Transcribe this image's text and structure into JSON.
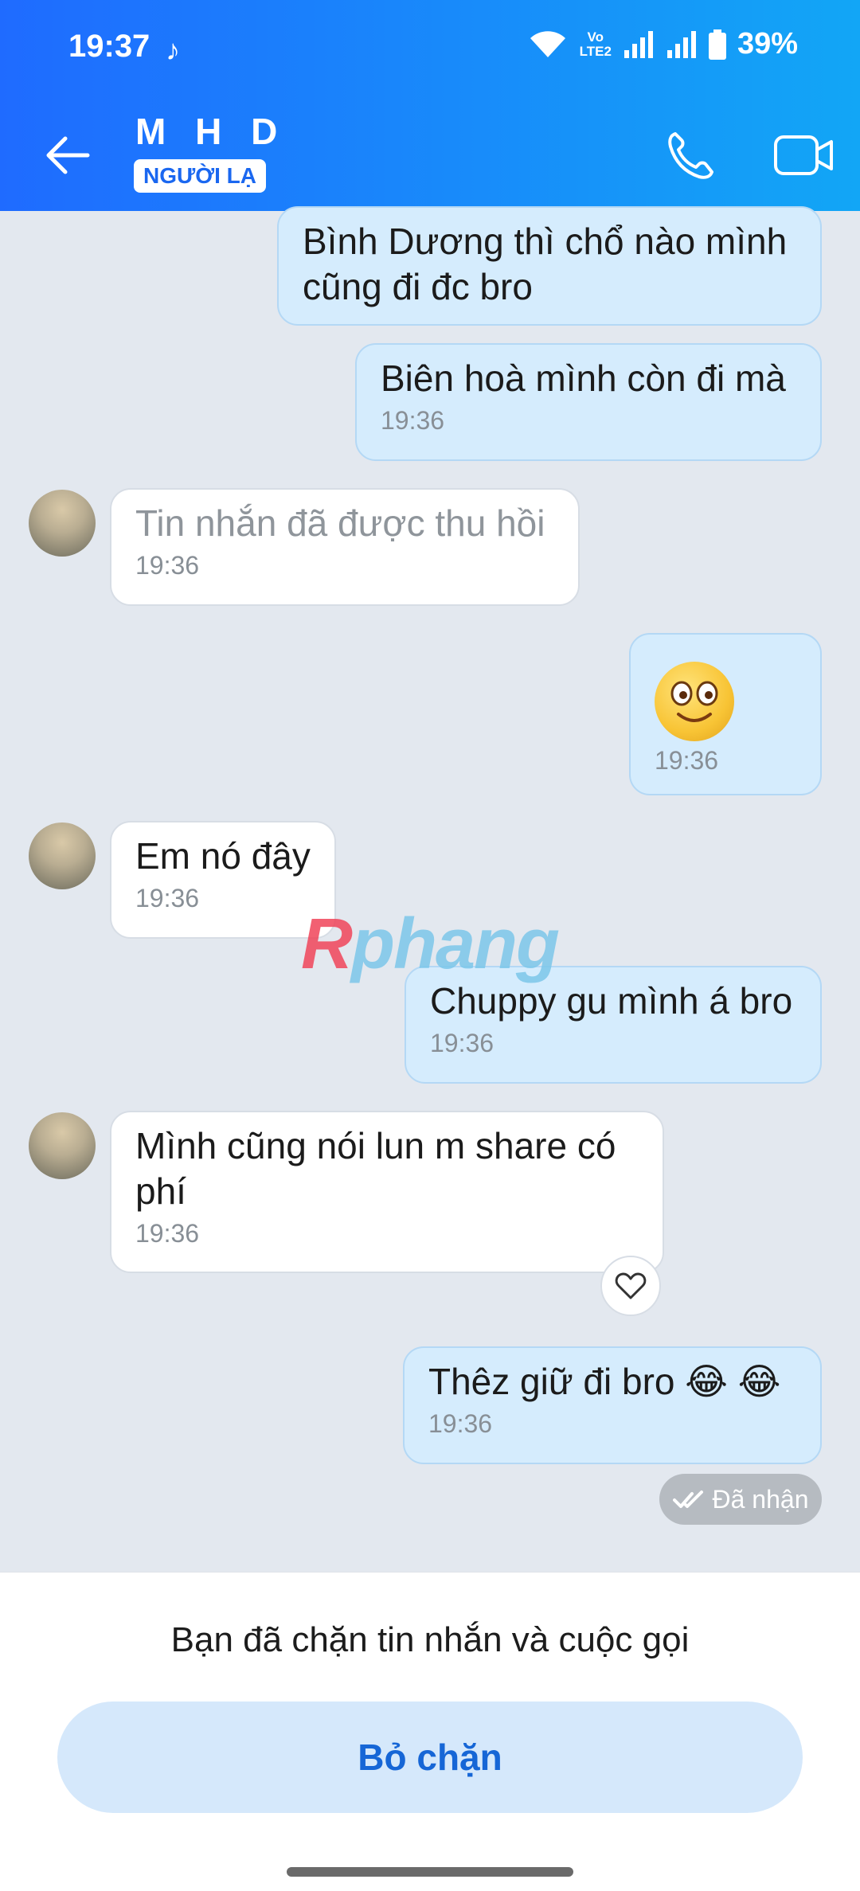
{
  "status_bar": {
    "time": "19:37",
    "tiktok_icon": "tiktok-icon",
    "volte": [
      "Vo",
      "LTE2"
    ],
    "battery": "39%"
  },
  "header": {
    "contact_name": "M H D",
    "stranger_label": "NGƯỜI LẠ",
    "accent_colors": [
      "#1f6bff",
      "#12a6f6"
    ]
  },
  "messages": [
    {
      "side": "out",
      "text": "Bình Dương thì chổ nào mình cũng đi đc bro",
      "time": ""
    },
    {
      "side": "out",
      "text": "Biên hoà mình còn đi mà",
      "time": "19:36"
    },
    {
      "side": "in",
      "text": "Tin nhắn đã được thu hồi",
      "time": "19:36",
      "recalled": true
    },
    {
      "side": "out",
      "text": "",
      "time": "19:36",
      "emoji": "smiling-face-emoji"
    },
    {
      "side": "in",
      "text": "Em nó đây",
      "time": "19:36"
    },
    {
      "side": "out",
      "text": "Chuppy gu mình á bro",
      "time": "19:36"
    },
    {
      "side": "in",
      "text": "Mình cũng nói lun m share có phí",
      "time": "19:36"
    },
    {
      "side": "out",
      "text": "Thêz giữ đi bro 😂 😂",
      "time": "19:36"
    }
  ],
  "delivery_status": "Đã nhận",
  "watermark": {
    "first": "R",
    "rest": "phang"
  },
  "footer": {
    "blocked_text": "Bạn đã chặn tin nhắn và cuộc gọi",
    "unblock_label": "Bỏ chặn"
  }
}
